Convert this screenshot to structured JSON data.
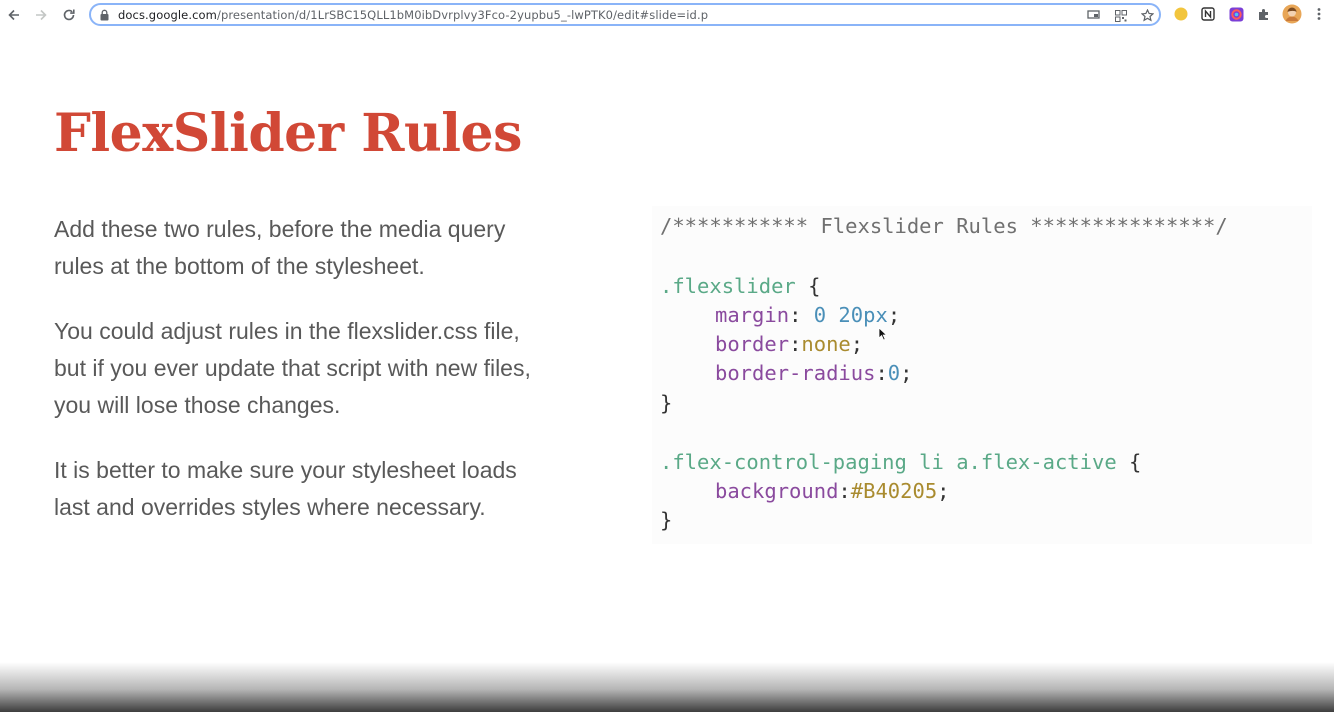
{
  "browser": {
    "url_host": "docs.google.com",
    "url_path": "/presentation/d/1LrSBC15QLL1bM0ibDvrplvy3Fco-2yupbu5_-lwPTK0/edit#slide=id.p",
    "icons": [
      "back-icon",
      "forward-icon",
      "reload-icon",
      "lock-icon",
      "cast-icon",
      "qr-code-icon",
      "bookmark-star-icon",
      "extension-yellow-icon",
      "extension-n-icon",
      "extension-circle-icon",
      "puzzle-extensions-icon",
      "profile-avatar",
      "menu-kebab-icon"
    ]
  },
  "slide": {
    "title": "FlexSlider Rules",
    "title_color": "#d14836",
    "paragraphs": [
      {
        "line1": "Add these two rules, before the media query",
        "line2": "rules at the bottom of the stylesheet."
      },
      {
        "line1": "You could adjust rules in the flexslider.css file,",
        "line2": "but if you ever update that script with new files,",
        "line3": "you will lose those changes."
      },
      {
        "line1": "It is better to make sure your stylesheet loads",
        "line2": "last and overrides styles where necessary."
      }
    ],
    "code": {
      "comment": "/*********** Flexslider Rules ***************/",
      "rule1": {
        "selector": ".flexslider",
        "open_brace": " {",
        "margin_prop": "margin",
        "margin_colon": ": ",
        "margin_value": "0 20px",
        "margin_end": ";",
        "border_prop": "border",
        "border_colon": ":",
        "border_value": "none",
        "border_end": ";",
        "radius_prop": "border-radius",
        "radius_colon": ":",
        "radius_value": "0",
        "radius_end": ";",
        "close_brace": "}"
      },
      "rule2": {
        "selector": ".flex-control-paging li a.flex-active",
        "open_brace": " {",
        "bg_prop": "background",
        "bg_colon": ":",
        "bg_value": "#B40205",
        "bg_end": ";",
        "close_brace": "}"
      }
    }
  }
}
